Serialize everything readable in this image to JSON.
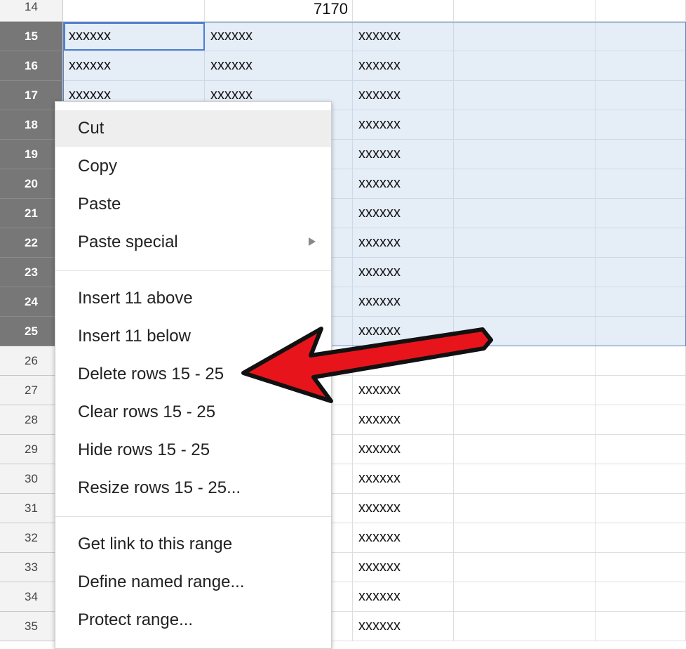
{
  "grid": {
    "rows": [
      {
        "num": "14",
        "selected": false,
        "a": "",
        "b": "7170",
        "c": ""
      },
      {
        "num": "15",
        "selected": true,
        "a": "xxxxxx",
        "b": "xxxxxx",
        "c": "xxxxxx"
      },
      {
        "num": "16",
        "selected": true,
        "a": "xxxxxx",
        "b": "xxxxxx",
        "c": "xxxxxx"
      },
      {
        "num": "17",
        "selected": true,
        "a": "xxxxxx",
        "b": "xxxxxx",
        "c": "xxxxxx"
      },
      {
        "num": "18",
        "selected": true,
        "a": "",
        "b": "",
        "c": "xxxxxx"
      },
      {
        "num": "19",
        "selected": true,
        "a": "",
        "b": "",
        "c": "xxxxxx"
      },
      {
        "num": "20",
        "selected": true,
        "a": "",
        "b": "",
        "c": "xxxxxx"
      },
      {
        "num": "21",
        "selected": true,
        "a": "",
        "b": "",
        "c": "xxxxxx"
      },
      {
        "num": "22",
        "selected": true,
        "a": "",
        "b": "",
        "c": "xxxxxx"
      },
      {
        "num": "23",
        "selected": true,
        "a": "",
        "b": "",
        "c": "xxxxxx"
      },
      {
        "num": "24",
        "selected": true,
        "a": "",
        "b": "",
        "c": "xxxxxx"
      },
      {
        "num": "25",
        "selected": true,
        "a": "",
        "b": "",
        "c": "xxxxxx"
      },
      {
        "num": "26",
        "selected": false,
        "a": "",
        "b": "",
        "c": "xxxxxx"
      },
      {
        "num": "27",
        "selected": false,
        "a": "",
        "b": "",
        "c": "xxxxxx"
      },
      {
        "num": "28",
        "selected": false,
        "a": "",
        "b": "",
        "c": "xxxxxx"
      },
      {
        "num": "29",
        "selected": false,
        "a": "",
        "b": "",
        "c": "xxxxxx"
      },
      {
        "num": "30",
        "selected": false,
        "a": "",
        "b": "",
        "c": "xxxxxx"
      },
      {
        "num": "31",
        "selected": false,
        "a": "",
        "b": "",
        "c": "xxxxxx"
      },
      {
        "num": "32",
        "selected": false,
        "a": "",
        "b": "",
        "c": "xxxxxx"
      },
      {
        "num": "33",
        "selected": false,
        "a": "",
        "b": "",
        "c": "xxxxxx"
      },
      {
        "num": "34",
        "selected": false,
        "a": "",
        "b": "",
        "c": "xxxxxx"
      },
      {
        "num": "35",
        "selected": false,
        "a": "",
        "b": "",
        "c": "xxxxxx"
      }
    ]
  },
  "context_menu": {
    "groups": [
      [
        {
          "label": "Cut",
          "hover": true
        },
        {
          "label": "Copy"
        },
        {
          "label": "Paste"
        },
        {
          "label": "Paste special",
          "submenu": true
        }
      ],
      [
        {
          "label": "Insert 11 above"
        },
        {
          "label": "Insert 11 below"
        },
        {
          "label": "Delete rows 15 - 25"
        },
        {
          "label": "Clear rows 15 - 25"
        },
        {
          "label": "Hide rows 15 - 25"
        },
        {
          "label": "Resize rows 15 - 25..."
        }
      ],
      [
        {
          "label": "Get link to this range"
        },
        {
          "label": "Define named range..."
        },
        {
          "label": "Protect range..."
        }
      ]
    ]
  },
  "annotation": {
    "type": "red-arrow",
    "target": "Delete rows 15 - 25",
    "color": "#e8141b"
  },
  "colors": {
    "selection_fill": "#e5edf7",
    "selection_border": "#5b84c4",
    "selected_header": "#777777",
    "header": "#f3f3f3"
  }
}
